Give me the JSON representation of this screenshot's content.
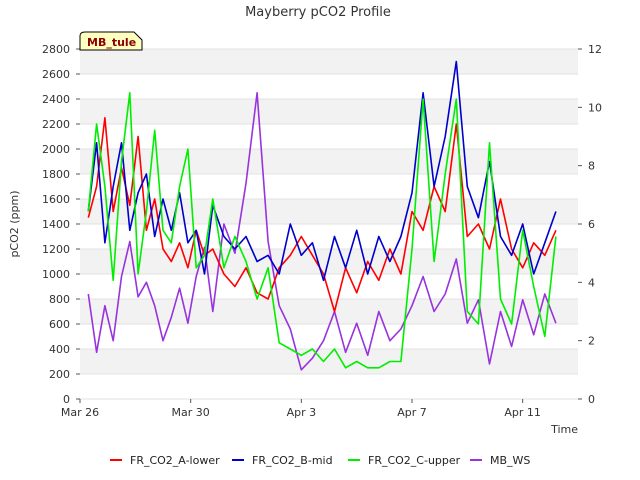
{
  "chart_data": {
    "type": "line",
    "title": "Mayberry pCO2 Profile",
    "xlabel": "Time",
    "ylabel": "pCO2 (ppm)",
    "y2label": "",
    "badge": "MB_tule",
    "x_ticks": [
      "Mar 26",
      "Mar 30",
      "Apr 3",
      "Apr 7",
      "Apr 11"
    ],
    "x_tick_days": [
      0,
      4,
      8,
      12,
      16
    ],
    "xlim_days": [
      0,
      18
    ],
    "ylim": [
      0,
      2800
    ],
    "y_ticks": [
      0,
      200,
      400,
      600,
      800,
      1000,
      1200,
      1400,
      1600,
      1800,
      2000,
      2200,
      2400,
      2600,
      2800
    ],
    "y2lim": [
      0,
      12
    ],
    "y2_ticks": [
      0,
      2,
      4,
      6,
      8,
      10,
      12
    ],
    "grid": "horizontal bands",
    "legend_position": "bottom",
    "series": [
      {
        "name": "FR_CO2_A-lower",
        "color": "#ff0000",
        "axis": "left",
        "points": [
          [
            0.3,
            1450
          ],
          [
            0.6,
            1700
          ],
          [
            0.9,
            2250
          ],
          [
            1.2,
            1500
          ],
          [
            1.5,
            1850
          ],
          [
            1.8,
            1550
          ],
          [
            2.1,
            2100
          ],
          [
            2.4,
            1350
          ],
          [
            2.7,
            1600
          ],
          [
            3.0,
            1200
          ],
          [
            3.3,
            1100
          ],
          [
            3.6,
            1250
          ],
          [
            3.9,
            1050
          ],
          [
            4.2,
            1350
          ],
          [
            4.5,
            1150
          ],
          [
            4.8,
            1200
          ],
          [
            5.2,
            1000
          ],
          [
            5.6,
            900
          ],
          [
            6.0,
            1050
          ],
          [
            6.4,
            850
          ],
          [
            6.8,
            800
          ],
          [
            7.2,
            1050
          ],
          [
            7.6,
            1150
          ],
          [
            8.0,
            1300
          ],
          [
            8.4,
            1150
          ],
          [
            8.8,
            1000
          ],
          [
            9.2,
            700
          ],
          [
            9.6,
            1050
          ],
          [
            10.0,
            850
          ],
          [
            10.4,
            1100
          ],
          [
            10.8,
            950
          ],
          [
            11.2,
            1200
          ],
          [
            11.6,
            1000
          ],
          [
            12.0,
            1500
          ],
          [
            12.4,
            1350
          ],
          [
            12.8,
            1700
          ],
          [
            13.2,
            1500
          ],
          [
            13.6,
            2200
          ],
          [
            14.0,
            1300
          ],
          [
            14.4,
            1400
          ],
          [
            14.8,
            1200
          ],
          [
            15.2,
            1600
          ],
          [
            15.6,
            1200
          ],
          [
            16.0,
            1050
          ],
          [
            16.4,
            1250
          ],
          [
            16.8,
            1150
          ],
          [
            17.2,
            1350
          ]
        ]
      },
      {
        "name": "FR_CO2_B-mid",
        "color": "#0000cc",
        "axis": "left",
        "points": [
          [
            0.3,
            1500
          ],
          [
            0.6,
            2050
          ],
          [
            0.9,
            1250
          ],
          [
            1.2,
            1700
          ],
          [
            1.5,
            2050
          ],
          [
            1.8,
            1350
          ],
          [
            2.1,
            1650
          ],
          [
            2.4,
            1800
          ],
          [
            2.7,
            1300
          ],
          [
            3.0,
            1600
          ],
          [
            3.3,
            1350
          ],
          [
            3.6,
            1650
          ],
          [
            3.9,
            1250
          ],
          [
            4.2,
            1350
          ],
          [
            4.5,
            1000
          ],
          [
            4.8,
            1550
          ],
          [
            5.2,
            1300
          ],
          [
            5.6,
            1200
          ],
          [
            6.0,
            1300
          ],
          [
            6.4,
            1100
          ],
          [
            6.8,
            1150
          ],
          [
            7.2,
            1000
          ],
          [
            7.6,
            1400
          ],
          [
            8.0,
            1150
          ],
          [
            8.4,
            1250
          ],
          [
            8.8,
            950
          ],
          [
            9.2,
            1300
          ],
          [
            9.6,
            1050
          ],
          [
            10.0,
            1350
          ],
          [
            10.4,
            1000
          ],
          [
            10.8,
            1300
          ],
          [
            11.2,
            1100
          ],
          [
            11.6,
            1300
          ],
          [
            12.0,
            1650
          ],
          [
            12.4,
            2450
          ],
          [
            12.8,
            1700
          ],
          [
            13.2,
            2100
          ],
          [
            13.6,
            2700
          ],
          [
            14.0,
            1700
          ],
          [
            14.4,
            1450
          ],
          [
            14.8,
            1900
          ],
          [
            15.2,
            1300
          ],
          [
            15.6,
            1150
          ],
          [
            16.0,
            1400
          ],
          [
            16.4,
            1000
          ],
          [
            16.8,
            1250
          ],
          [
            17.2,
            1500
          ]
        ]
      },
      {
        "name": "FR_CO2_C-upper",
        "color": "#00ee00",
        "axis": "left",
        "points": [
          [
            0.3,
            1500
          ],
          [
            0.6,
            2200
          ],
          [
            0.9,
            1700
          ],
          [
            1.2,
            950
          ],
          [
            1.5,
            1900
          ],
          [
            1.8,
            2450
          ],
          [
            2.1,
            1000
          ],
          [
            2.4,
            1500
          ],
          [
            2.7,
            2150
          ],
          [
            3.0,
            1350
          ],
          [
            3.3,
            1250
          ],
          [
            3.6,
            1700
          ],
          [
            3.9,
            2000
          ],
          [
            4.2,
            1050
          ],
          [
            4.5,
            1150
          ],
          [
            4.8,
            1600
          ],
          [
            5.2,
            1050
          ],
          [
            5.6,
            1300
          ],
          [
            6.0,
            1100
          ],
          [
            6.4,
            800
          ],
          [
            6.8,
            1050
          ],
          [
            7.2,
            450
          ],
          [
            7.6,
            400
          ],
          [
            8.0,
            350
          ],
          [
            8.4,
            400
          ],
          [
            8.8,
            300
          ],
          [
            9.2,
            400
          ],
          [
            9.6,
            250
          ],
          [
            10.0,
            300
          ],
          [
            10.4,
            250
          ],
          [
            10.8,
            250
          ],
          [
            11.2,
            300
          ],
          [
            11.6,
            300
          ],
          [
            12.0,
            1200
          ],
          [
            12.4,
            2400
          ],
          [
            12.8,
            1100
          ],
          [
            13.2,
            1800
          ],
          [
            13.6,
            2400
          ],
          [
            14.0,
            700
          ],
          [
            14.4,
            600
          ],
          [
            14.8,
            2050
          ],
          [
            15.2,
            800
          ],
          [
            15.6,
            600
          ],
          [
            16.0,
            1350
          ],
          [
            16.4,
            900
          ],
          [
            16.8,
            500
          ],
          [
            17.2,
            1300
          ]
        ]
      },
      {
        "name": "MB_WS",
        "color": "#9933dd",
        "axis": "right",
        "points": [
          [
            0.3,
            3.6
          ],
          [
            0.6,
            1.6
          ],
          [
            0.9,
            3.2
          ],
          [
            1.2,
            2.0
          ],
          [
            1.5,
            4.2
          ],
          [
            1.8,
            5.4
          ],
          [
            2.1,
            3.5
          ],
          [
            2.4,
            4.0
          ],
          [
            2.7,
            3.2
          ],
          [
            3.0,
            2.0
          ],
          [
            3.3,
            2.8
          ],
          [
            3.6,
            3.8
          ],
          [
            3.9,
            2.6
          ],
          [
            4.2,
            4.2
          ],
          [
            4.5,
            5.2
          ],
          [
            4.8,
            3.0
          ],
          [
            5.2,
            6.0
          ],
          [
            5.6,
            5.0
          ],
          [
            6.0,
            7.4
          ],
          [
            6.4,
            10.5
          ],
          [
            6.8,
            5.4
          ],
          [
            7.2,
            3.2
          ],
          [
            7.6,
            2.4
          ],
          [
            8.0,
            1.0
          ],
          [
            8.4,
            1.4
          ],
          [
            8.8,
            2.0
          ],
          [
            9.2,
            3.0
          ],
          [
            9.6,
            1.6
          ],
          [
            10.0,
            2.6
          ],
          [
            10.4,
            1.5
          ],
          [
            10.8,
            3.0
          ],
          [
            11.2,
            2.0
          ],
          [
            11.6,
            2.4
          ],
          [
            12.0,
            3.2
          ],
          [
            12.4,
            4.2
          ],
          [
            12.8,
            3.0
          ],
          [
            13.2,
            3.6
          ],
          [
            13.6,
            4.8
          ],
          [
            14.0,
            2.6
          ],
          [
            14.4,
            3.4
          ],
          [
            14.8,
            1.2
          ],
          [
            15.2,
            3.0
          ],
          [
            15.6,
            1.8
          ],
          [
            16.0,
            3.4
          ],
          [
            16.4,
            2.2
          ],
          [
            16.8,
            3.6
          ],
          [
            17.2,
            2.6
          ]
        ]
      }
    ]
  }
}
